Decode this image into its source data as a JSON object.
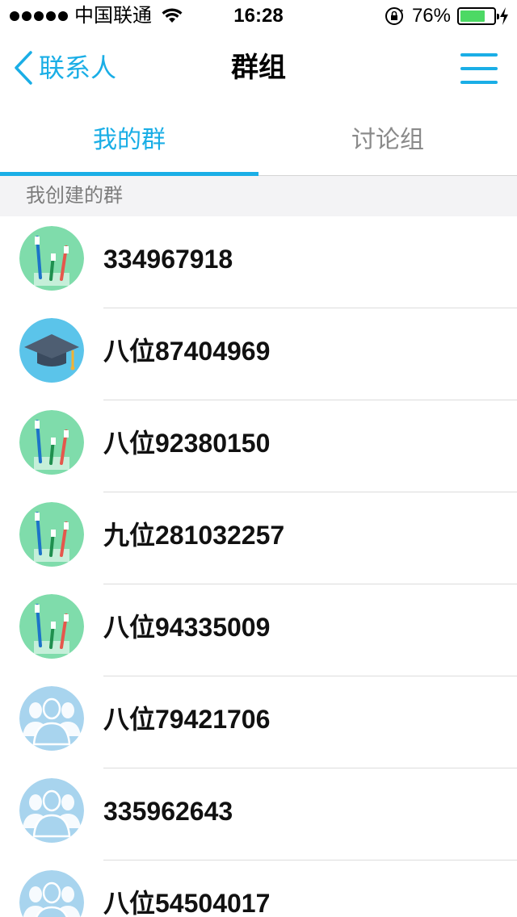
{
  "status_bar": {
    "carrier": "中国联通",
    "time": "16:28",
    "battery_percent": "76%",
    "battery_level": 0.76,
    "icons": [
      "signal-dots-icon",
      "wifi-icon",
      "rotation-lock-icon",
      "battery-icon",
      "charging-icon"
    ]
  },
  "nav": {
    "back_label": "联系人",
    "title": "群组",
    "menu_icon": "hamburger-menu-icon"
  },
  "tabs": [
    {
      "label": "我的群",
      "active": true
    },
    {
      "label": "讨论组",
      "active": false
    }
  ],
  "section": {
    "header": "我创建的群"
  },
  "groups": [
    {
      "name": "334967918",
      "avatar": "toothbrush-icon"
    },
    {
      "name": "八位87404969",
      "avatar": "graduation-cap-icon"
    },
    {
      "name": "八位92380150",
      "avatar": "toothbrush-icon"
    },
    {
      "name": "九位281032257",
      "avatar": "toothbrush-icon"
    },
    {
      "name": "八位94335009",
      "avatar": "toothbrush-icon"
    },
    {
      "name": "八位79421706",
      "avatar": "people-icon"
    },
    {
      "name": "335962643",
      "avatar": "people-icon"
    },
    {
      "name": "八位54504017",
      "avatar": "people-icon"
    }
  ],
  "colors": {
    "accent": "#1aaee6",
    "toothbrush_bg": "#7fdcab",
    "cap_bg": "#5bc4ea",
    "people_bg": "#a8d4ee"
  }
}
